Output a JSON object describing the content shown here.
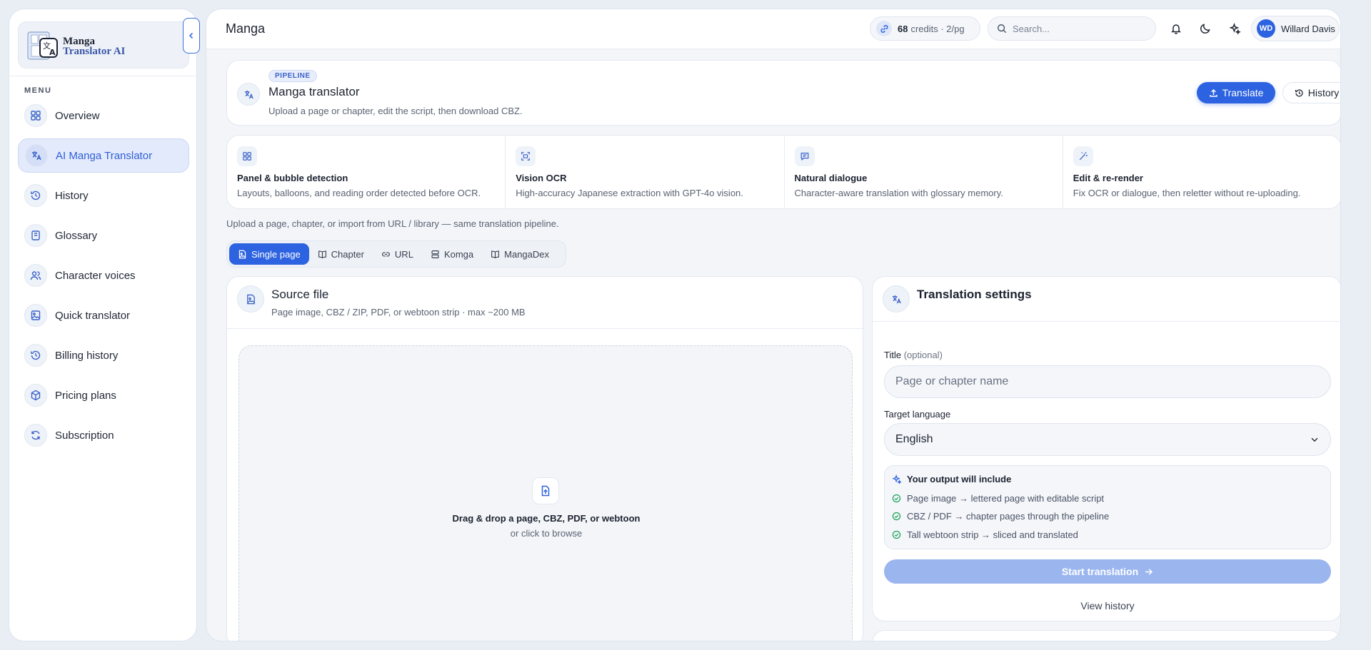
{
  "sidebar": {
    "logo": {
      "line1": "Manga",
      "line2": "Translator AI"
    },
    "menu_label": "MENU",
    "items": [
      {
        "label": "Overview",
        "icon": "grid-icon"
      },
      {
        "label": "AI Manga Translator",
        "icon": "translate-icon",
        "active": true
      },
      {
        "label": "History",
        "icon": "history-icon"
      },
      {
        "label": "Glossary",
        "icon": "book-icon"
      },
      {
        "label": "Character voices",
        "icon": "users-icon"
      },
      {
        "label": "Quick translator",
        "icon": "image-file-icon"
      },
      {
        "label": "Billing history",
        "icon": "history-icon"
      },
      {
        "label": "Pricing plans",
        "icon": "package-icon"
      },
      {
        "label": "Subscription",
        "icon": "refresh-icon"
      }
    ]
  },
  "topbar": {
    "title": "Manga",
    "credits_count": "68",
    "credits_text": "credits · 2/pg",
    "search_placeholder": "Search...",
    "user_initials": "WD",
    "user_name": "Willard Davis"
  },
  "hero": {
    "badge": "PIPELINE",
    "title": "Manga translator",
    "subtitle": "Upload a page or chapter, edit the script, then download CBZ.",
    "translate_label": "Translate",
    "history_label": "History"
  },
  "features": [
    {
      "title": "Panel & bubble detection",
      "desc": "Layouts, balloons, and reading order detected before OCR.",
      "icon": "grid-icon"
    },
    {
      "title": "Vision OCR",
      "desc": "High-accuracy Japanese extraction with GPT-4o vision.",
      "icon": "scan-icon"
    },
    {
      "title": "Natural dialogue",
      "desc": "Character-aware translation with glossary memory.",
      "icon": "message-icon"
    },
    {
      "title": "Edit & re-render",
      "desc": "Fix OCR or dialogue, then reletter without re-uploading.",
      "icon": "wand-icon"
    }
  ],
  "upload_note": "Upload a page, chapter, or import from URL / library — same translation pipeline.",
  "tabs": [
    {
      "label": "Single page",
      "active": true
    },
    {
      "label": "Chapter"
    },
    {
      "label": "URL"
    },
    {
      "label": "Komga"
    },
    {
      "label": "MangaDex"
    }
  ],
  "source": {
    "title": "Source file",
    "subtitle": "Page image, CBZ / ZIP, PDF, or webtoon strip · max ~200 MB",
    "drop_title": "Drag & drop a page, CBZ, PDF, or webtoon",
    "drop_sub": "or click to browse"
  },
  "settings": {
    "title": "Translation settings",
    "title_label": "Title",
    "title_optional": "(optional)",
    "title_placeholder": "Page or chapter name",
    "lang_label": "Target language",
    "lang_value": "English",
    "output_title": "Your output will include",
    "output_items": [
      "Page image → lettered page with editable script",
      "CBZ / PDF → chapter pages through the pipeline",
      "Tall webtoon strip → sliced and translated"
    ],
    "start_label": "Start translation",
    "view_history": "View history"
  },
  "colors": {
    "accent": "#2d63e0",
    "accent_disabled": "#9bb6ef",
    "check": "#22a45d"
  }
}
